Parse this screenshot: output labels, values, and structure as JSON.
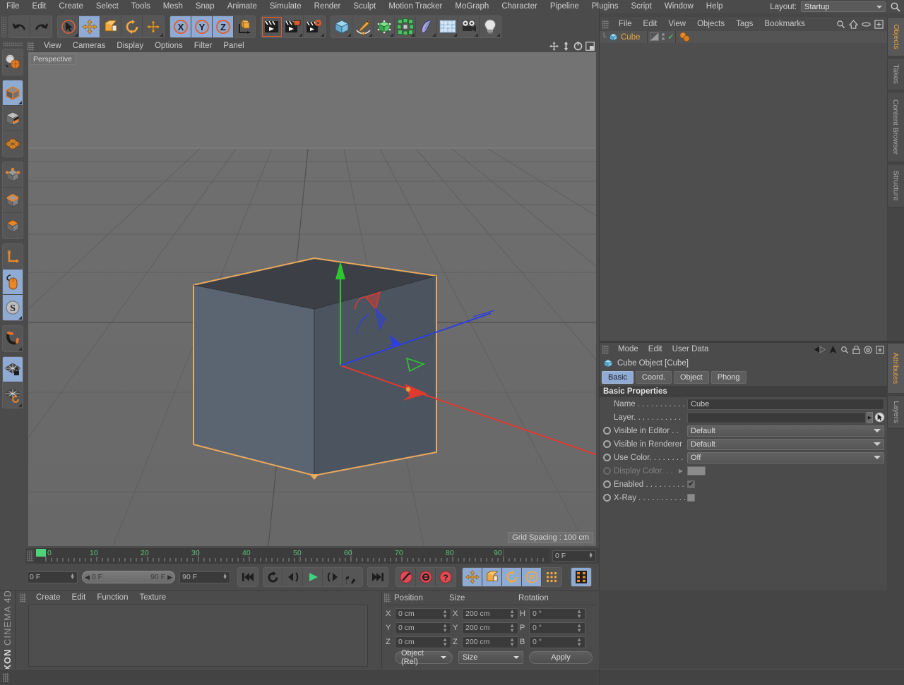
{
  "app": {
    "brand_top": "MAXON",
    "brand_bottom": "CINEMA 4D"
  },
  "menubar": {
    "items": [
      "File",
      "Edit",
      "Create",
      "Select",
      "Tools",
      "Mesh",
      "Snap",
      "Animate",
      "Simulate",
      "Render",
      "Sculpt",
      "Motion Tracker",
      "MoGraph",
      "Character",
      "Pipeline",
      "Plugins",
      "Script",
      "Window",
      "Help"
    ],
    "layout_label": "Layout:",
    "layout_value": "Startup",
    "search_icon": "search-icon"
  },
  "toolbar": {
    "groups": [
      {
        "name": "undo-redo",
        "buttons": [
          {
            "name": "undo-button",
            "icon": "undo-arrow-icon",
            "state": "off"
          },
          {
            "name": "redo-button",
            "icon": "redo-arrow-icon",
            "state": "off"
          }
        ]
      },
      {
        "name": "transform-tools",
        "buttons": [
          {
            "name": "live-selection-button",
            "icon": "cursor-circle-icon",
            "state": "off"
          },
          {
            "name": "move-tool-button",
            "icon": "move-arrows-icon",
            "state": "on"
          },
          {
            "name": "scale-tool-button",
            "icon": "scale-box-icon",
            "state": "off"
          },
          {
            "name": "rotate-tool-button",
            "icon": "rotate-circle-icon",
            "state": "off"
          },
          {
            "name": "dynamic-place-button",
            "icon": "move-arrows-icon",
            "state": "off"
          }
        ]
      },
      {
        "name": "axis-locks",
        "buttons": [
          {
            "name": "lock-x-button",
            "icon": "x-axis-icon",
            "label": "X",
            "state": "on"
          },
          {
            "name": "lock-y-button",
            "icon": "y-axis-icon",
            "label": "Y",
            "state": "on"
          },
          {
            "name": "lock-z-button",
            "icon": "z-axis-icon",
            "label": "Z",
            "state": "on"
          },
          {
            "name": "world-object-coord-button",
            "icon": "world-axis-cube-icon",
            "state": "off"
          }
        ]
      },
      {
        "name": "render-tools",
        "buttons": [
          {
            "name": "render-view-button",
            "icon": "clapperboard-icon",
            "state": "off"
          },
          {
            "name": "render-to-picture-viewer-button",
            "icon": "clapperboard-picture-icon",
            "state": "off"
          },
          {
            "name": "render-settings-button",
            "icon": "clapperboard-gear-icon",
            "state": "off"
          }
        ]
      },
      {
        "name": "create-objects",
        "buttons": [
          {
            "name": "primitive-cube-button",
            "icon": "blue-cube-icon",
            "state": "off"
          },
          {
            "name": "spline-pen-button",
            "icon": "pen-spline-icon",
            "state": "off"
          },
          {
            "name": "generator-button",
            "icon": "green-cube-cage-icon",
            "state": "off"
          },
          {
            "name": "mograph-cloner-button",
            "icon": "cloner-icon",
            "state": "off"
          },
          {
            "name": "deformer-button",
            "icon": "bend-deformer-icon",
            "state": "off"
          },
          {
            "name": "scene-environment-button",
            "icon": "floor-grid-icon",
            "state": "off"
          },
          {
            "name": "camera-button",
            "icon": "camera-icon",
            "state": "off"
          },
          {
            "name": "light-button",
            "icon": "lightbulb-icon",
            "state": "off"
          }
        ]
      }
    ]
  },
  "left_palette": {
    "groups": [
      {
        "buttons": [
          {
            "name": "make-editable-button",
            "icon": "sphere-to-polygon-icon",
            "state": "off"
          }
        ]
      },
      {
        "buttons": [
          {
            "name": "model-mode-button",
            "icon": "model-cube-icon",
            "state": "on"
          },
          {
            "name": "texture-mode-button",
            "icon": "texture-checker-cube-icon",
            "state": "off"
          },
          {
            "name": "workplane-mode-button",
            "icon": "workplane-grid-icon",
            "state": "off"
          }
        ]
      },
      {
        "buttons": [
          {
            "name": "points-mode-button",
            "icon": "points-cube-icon",
            "state": "off"
          },
          {
            "name": "edges-mode-button",
            "icon": "edges-cube-icon",
            "state": "off"
          },
          {
            "name": "polygons-mode-button",
            "icon": "polygons-cube-icon",
            "state": "off"
          }
        ]
      },
      {
        "buttons": [
          {
            "name": "object-axis-mode-button",
            "icon": "axis-l-icon",
            "state": "off"
          },
          {
            "name": "enable-axis-modification-button",
            "icon": "mouse-icon",
            "state": "on"
          },
          {
            "name": "soft-selection-button",
            "icon": "s-circle-icon",
            "state": "on"
          }
        ]
      },
      {
        "buttons": [
          {
            "name": "snap-magnet-button",
            "icon": "magnet-icon",
            "state": "off"
          }
        ]
      },
      {
        "buttons": [
          {
            "name": "lock-workplane-button",
            "icon": "grid-lock-icon",
            "state": "on"
          },
          {
            "name": "workplane-rotate-button",
            "icon": "grid-rotate-icon",
            "state": "off"
          }
        ]
      }
    ]
  },
  "viewport": {
    "menu": [
      "View",
      "Cameras",
      "Display",
      "Options",
      "Filter",
      "Panel"
    ],
    "corner_icons": [
      "pan-icon",
      "dolly-icon",
      "rotate-icon",
      "maximize-icon"
    ],
    "perspective_label": "Perspective",
    "grid_spacing_label": "Grid Spacing : 100 cm",
    "axis_gizmo": {
      "x": "X",
      "y": "Y",
      "z": "Z"
    },
    "colors": {
      "background": "#6c6c6c",
      "cube_front": "#58616e",
      "cube_top": "#3a3d42",
      "cube_outline": "#e8a95e",
      "axis_x": "#e03a2f",
      "axis_y": "#2ec62e",
      "axis_z": "#2d3fe0"
    }
  },
  "timeline": {
    "tick_labels": [
      "0",
      "10",
      "20",
      "30",
      "40",
      "50",
      "60",
      "70",
      "80",
      "90"
    ],
    "current_frame_marker": "0",
    "end_field": "0 F"
  },
  "animbar": {
    "current_frame": "0 F",
    "range_start": "0 F",
    "range_end": "90 F",
    "max_frame": "90 F",
    "transport": [
      {
        "name": "go-to-start-button",
        "icon": "skip-start-icon"
      },
      {
        "name": "loop-button",
        "icon": "loop-icon"
      },
      {
        "name": "step-back-button",
        "icon": "step-back-icon"
      },
      {
        "name": "play-button",
        "icon": "play-icon"
      },
      {
        "name": "step-forward-button",
        "icon": "step-forward-icon"
      },
      {
        "name": "play-reverse-button",
        "icon": "play-reverse-icon"
      },
      {
        "name": "go-to-end-button",
        "icon": "skip-end-icon"
      }
    ],
    "keys": [
      {
        "name": "record-keyframe-button",
        "icon": "record-key-icon"
      },
      {
        "name": "autokeying-button",
        "icon": "autokey-icon"
      },
      {
        "name": "keyframe-selection-button",
        "icon": "question-key-icon"
      }
    ],
    "key_params": [
      {
        "name": "position-key-button",
        "icon": "move-arrows-icon",
        "state": "on"
      },
      {
        "name": "scale-key-button",
        "icon": "scale-box-icon",
        "state": "on"
      },
      {
        "name": "rotation-key-button",
        "icon": "rotate-circle-icon",
        "state": "on"
      },
      {
        "name": "param-key-button",
        "icon": "p-circle-icon",
        "state": "on"
      },
      {
        "name": "point-level-animation-button",
        "icon": "pla-dots-icon",
        "state": "off"
      }
    ],
    "last": {
      "name": "timeline-toggle-button",
      "icon": "film-strip-icon",
      "state": "on"
    }
  },
  "material_manager": {
    "menu": [
      "Create",
      "Edit",
      "Function",
      "Texture"
    ]
  },
  "coordinates": {
    "columns": [
      "Position",
      "Size",
      "Rotation"
    ],
    "rows": [
      {
        "pos_label": "X",
        "pos_value": "0 cm",
        "size_label": "X",
        "size_value": "200 cm",
        "rot_label": "H",
        "rot_value": "0 °"
      },
      {
        "pos_label": "Y",
        "pos_value": "0 cm",
        "size_label": "Y",
        "size_value": "200 cm",
        "rot_label": "P",
        "rot_value": "0 °"
      },
      {
        "pos_label": "Z",
        "pos_value": "0 cm",
        "size_label": "Z",
        "size_value": "200 cm",
        "rot_label": "B",
        "rot_value": "0 °"
      }
    ],
    "mode_dropdown": "Object (Rel)",
    "size_dropdown": "Size",
    "apply_button": "Apply"
  },
  "object_manager": {
    "menu": [
      "File",
      "Edit",
      "View",
      "Objects",
      "Tags",
      "Bookmarks"
    ],
    "icons": [
      "search-icon",
      "home-icon",
      "ellipse-icon",
      "add-layer-icon"
    ],
    "objects": [
      {
        "name": "Cube",
        "icon": "blue-cube-icon",
        "visibility_top": "dot",
        "visibility_bottom": "dot",
        "check": "✓"
      }
    ]
  },
  "attribute_manager": {
    "menu": [
      "Mode",
      "Edit",
      "User Data"
    ],
    "icons": [
      "back-arrow-icon",
      "up-arrow-icon",
      "search-icon",
      "lock-icon",
      "target-icon",
      "add-icon"
    ],
    "title": "Cube Object [Cube]",
    "title_icon": "blue-cube-icon",
    "tabs": [
      {
        "label": "Basic",
        "selected": true
      },
      {
        "label": "Coord.",
        "selected": false
      },
      {
        "label": "Object",
        "selected": false
      },
      {
        "label": "Phong",
        "selected": false
      }
    ],
    "section_title": "Basic Properties",
    "properties": [
      {
        "label": "Name . . . . . . . . . . .",
        "type": "text",
        "value": "Cube",
        "name": "name-field",
        "dim": false,
        "radio": false
      },
      {
        "label": "Layer. . . . . . . . . . .",
        "type": "layer",
        "value": "",
        "name": "layer-field",
        "dim": false,
        "radio": false
      },
      {
        "label": "Visible in Editor  . .",
        "type": "select",
        "value": "Default",
        "name": "visible-in-editor-select",
        "dim": false,
        "radio": true
      },
      {
        "label": "Visible in Renderer",
        "type": "select",
        "value": "Default",
        "name": "visible-in-renderer-select",
        "dim": false,
        "radio": true
      },
      {
        "label": "Use Color. . . . . . . .",
        "type": "select",
        "value": "Off",
        "name": "use-color-select",
        "dim": false,
        "radio": true
      },
      {
        "label": "Display Color. . .",
        "type": "color",
        "value": "",
        "name": "display-color-swatch",
        "dim": true,
        "radio": true
      },
      {
        "label": "Enabled . . . . . . . . .",
        "type": "check",
        "value": "✔",
        "name": "enabled-checkbox",
        "dim": false,
        "radio": true
      },
      {
        "label": "X-Ray . . . . . . . . . . .",
        "type": "checkoff",
        "value": "",
        "name": "xray-checkbox",
        "dim": false,
        "radio": true
      }
    ]
  },
  "right_tabs_top": [
    {
      "label": "Objects",
      "selected": true
    },
    {
      "label": "Takes",
      "selected": false
    },
    {
      "label": "Content Browser",
      "selected": false
    },
    {
      "label": "Structure",
      "selected": false
    }
  ],
  "right_tabs_bottom": [
    {
      "label": "Attributes",
      "selected": true
    },
    {
      "label": "Layers",
      "selected": false
    }
  ]
}
